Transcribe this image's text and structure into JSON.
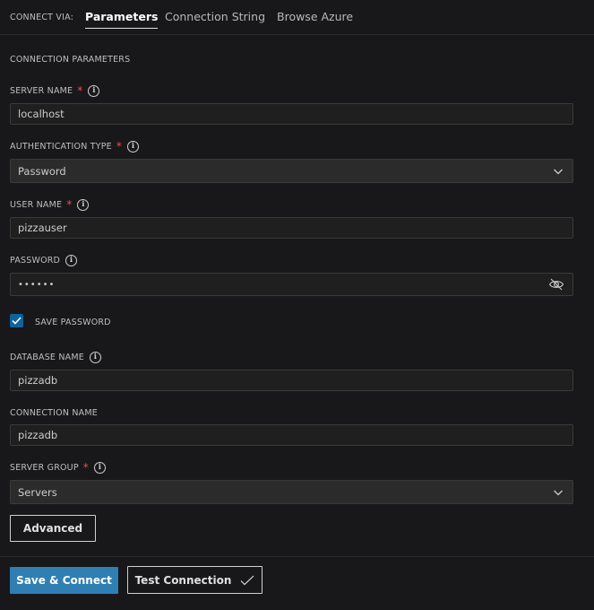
{
  "tabs": {
    "connect_via_label": "CONNECT VIA:",
    "items": [
      {
        "label": "Parameters",
        "active": true
      },
      {
        "label": "Connection String",
        "active": false
      },
      {
        "label": "Browse Azure",
        "active": false
      }
    ]
  },
  "section_title": "CONNECTION PARAMETERS",
  "fields": {
    "server_name": {
      "label": "SERVER NAME",
      "required": "*",
      "value": "localhost"
    },
    "auth_type": {
      "label": "AUTHENTICATION TYPE",
      "required": "*",
      "value": "Password"
    },
    "user_name": {
      "label": "USER NAME",
      "required": "*",
      "value": "pizzauser"
    },
    "password": {
      "label": "PASSWORD",
      "value": "••••••"
    },
    "database_name": {
      "label": "DATABASE NAME",
      "value": "pizzadb"
    },
    "connection_name": {
      "label": "CONNECTION NAME",
      "value": "pizzadb"
    },
    "server_group": {
      "label": "SERVER GROUP",
      "required": "*",
      "value": "Servers"
    }
  },
  "save_password": {
    "label": "SAVE PASSWORD",
    "checked": true
  },
  "buttons": {
    "advanced": "Advanced",
    "save_connect": "Save & Connect",
    "test_connection": "Test Connection"
  },
  "icons": {
    "info": "info-icon",
    "chevron": "chevron-down-icon",
    "eye": "eye-off-icon",
    "check": "check-icon"
  },
  "colors": {
    "background": "#18181a",
    "accent": "#2f7fb3",
    "required": "#f14c4c",
    "checkbox": "#0e639c"
  }
}
